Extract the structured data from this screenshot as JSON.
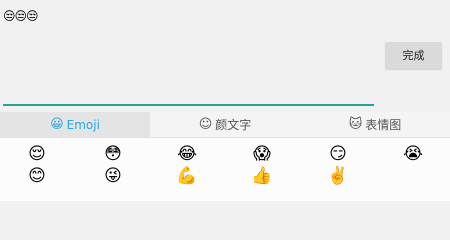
{
  "compose": {
    "typed_text": "😒😒😒",
    "done_label": "完成"
  },
  "tabs": [
    {
      "icon": "😀",
      "label": "Emoji",
      "active": true
    },
    {
      "icon": "☺",
      "label": "颜文字",
      "active": false
    },
    {
      "icon": "🐱",
      "label": "表情图",
      "active": false
    }
  ],
  "emoji_grid": [
    [
      "😌",
      "😳",
      "😂",
      "😱",
      "😏",
      "😭"
    ],
    [
      "😊",
      "😜",
      "💪",
      "👍",
      "✌️"
    ]
  ],
  "colors": {
    "accent": "#2aa7df",
    "input_line": "#26a69a"
  }
}
